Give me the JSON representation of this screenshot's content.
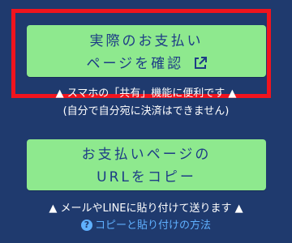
{
  "primary_button": {
    "line1": "実際のお支払い",
    "line2": "ページを確認",
    "icon": "external-link-icon"
  },
  "primary_note": "▲ スマホの「共有」機能に便利です ▲",
  "self_payment_note": "(自分で自分宛に決済はできません)",
  "secondary_button": {
    "line1": "お支払いページの",
    "line2": "URLをコピー"
  },
  "secondary_note": "▲ メールやLINEに貼り付けて送ります ▲",
  "help_link": {
    "icon": "help-icon",
    "label": "コピーと貼り付けの方法"
  },
  "colors": {
    "background": "#1f3a6e",
    "button": "#8ee98e",
    "button_text": "#1d3c86",
    "highlight": "#f0141e",
    "link": "#5fb0ff"
  }
}
